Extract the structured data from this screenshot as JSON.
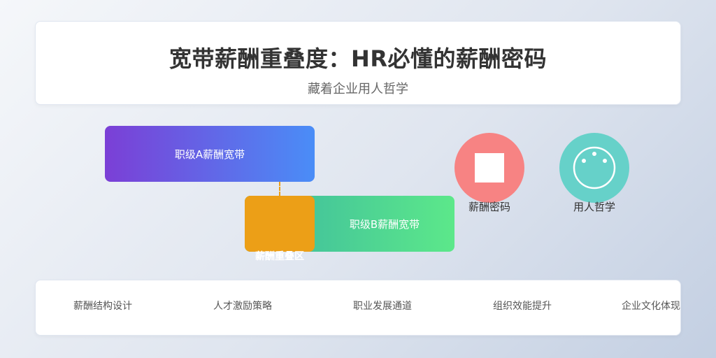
{
  "header": {
    "title": "宽带薪酬重叠度：HR必懂的薪酬密码",
    "subtitle": "藏着企业用人哲学"
  },
  "diagram": {
    "band_a_label": "职级A薪酬宽带",
    "band_b_label": "职级B薪酬宽带",
    "overlap_label": "薪酬重叠区",
    "circle_code_label": "薪酬密码",
    "circle_philosophy_label": "用人哲学"
  },
  "footer": {
    "tags": [
      {
        "icon": "",
        "label": "薪酬结构设计"
      },
      {
        "icon": "",
        "label": "人才激励策略"
      },
      {
        "icon": "",
        "label": "职业发展通道"
      },
      {
        "icon": "",
        "label": "组织效能提升"
      },
      {
        "icon": "",
        "label": "企业文化体现"
      }
    ]
  },
  "colors": {
    "band_a": [
      "#7b3fd6",
      "#4a8df7"
    ],
    "band_b": [
      "#3bb7a0",
      "#5ce88a"
    ],
    "overlap": "#ec9f17",
    "circle_code": "#f78383",
    "circle_philosophy": "#66d1c9"
  }
}
